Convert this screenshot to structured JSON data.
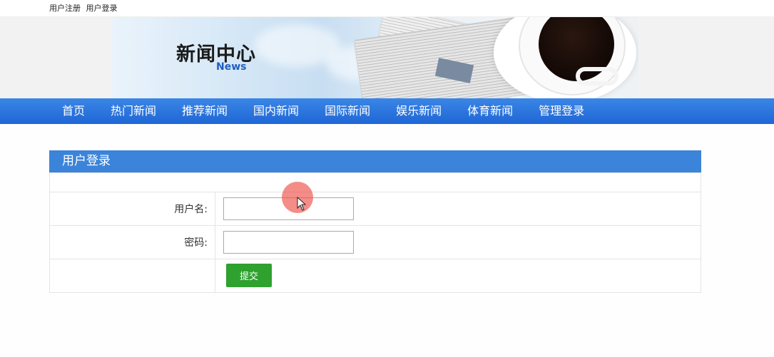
{
  "topbar": {
    "links": [
      {
        "label": "用户注册"
      },
      {
        "label": "用户登录"
      }
    ]
  },
  "banner": {
    "title": "新闻中心",
    "subtitle": "News"
  },
  "nav": {
    "items": [
      {
        "label": "首页"
      },
      {
        "label": "热门新闻"
      },
      {
        "label": "推荐新闻"
      },
      {
        "label": "国内新闻"
      },
      {
        "label": "国际新闻"
      },
      {
        "label": "娱乐新闻"
      },
      {
        "label": "体育新闻"
      },
      {
        "label": "管理登录"
      }
    ]
  },
  "login": {
    "heading": "用户登录",
    "username_label": "用户名:",
    "username_value": "",
    "password_label": "密码:",
    "password_value": "",
    "submit_label": "提交"
  },
  "colors": {
    "nav_bg": "#1f66d6",
    "panel_head": "#3b84da",
    "submit_bg": "#2ea12e"
  },
  "icons": {
    "cursor": "mouse-pointer-icon"
  }
}
